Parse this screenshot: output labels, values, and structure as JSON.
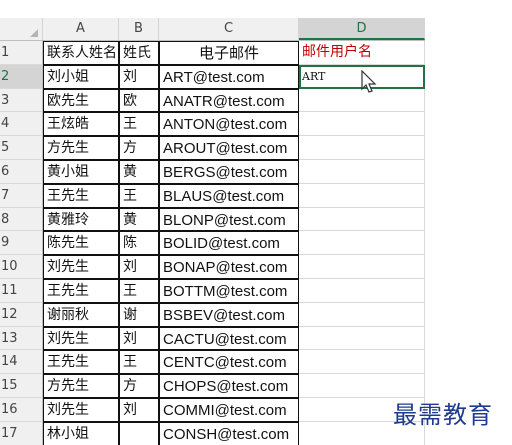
{
  "columns": [
    "A",
    "B",
    "C",
    "D"
  ],
  "header": {
    "row_num": "1",
    "contact_name": "联系人姓名",
    "surname": "姓氏",
    "email": "电子邮件",
    "username": "邮件用户名"
  },
  "rows": [
    {
      "num": "2",
      "name": "刘小姐",
      "surname": "刘",
      "email": "ART@test.com",
      "username": "ART"
    },
    {
      "num": "3",
      "name": "欧先生",
      "surname": "欧",
      "email": "ANATR@test.com",
      "username": ""
    },
    {
      "num": "4",
      "name": "王炫皓",
      "surname": "王",
      "email": "ANTON@test.com",
      "username": ""
    },
    {
      "num": "5",
      "name": "方先生",
      "surname": "方",
      "email": "AROUT@test.com",
      "username": ""
    },
    {
      "num": "6",
      "name": "黄小姐",
      "surname": "黄",
      "email": "BERGS@test.com",
      "username": ""
    },
    {
      "num": "7",
      "name": "王先生",
      "surname": "王",
      "email": "BLAUS@test.com",
      "username": ""
    },
    {
      "num": "8",
      "name": "黄雅玲",
      "surname": "黄",
      "email": "BLONP@test.com",
      "username": ""
    },
    {
      "num": "9",
      "name": "陈先生",
      "surname": "陈",
      "email": "BOLID@test.com",
      "username": ""
    },
    {
      "num": "10",
      "name": "刘先生",
      "surname": "刘",
      "email": "BONAP@test.com",
      "username": ""
    },
    {
      "num": "11",
      "name": "王先生",
      "surname": "王",
      "email": "BOTTM@test.com",
      "username": ""
    },
    {
      "num": "12",
      "name": "谢丽秋",
      "surname": "谢",
      "email": "BSBEV@test.com",
      "username": ""
    },
    {
      "num": "13",
      "name": "刘先生",
      "surname": "刘",
      "email": "CACTU@test.com",
      "username": ""
    },
    {
      "num": "14",
      "name": "王先生",
      "surname": "王",
      "email": "CENTC@test.com",
      "username": ""
    },
    {
      "num": "15",
      "name": "方先生",
      "surname": "方",
      "email": "CHOPS@test.com",
      "username": ""
    },
    {
      "num": "16",
      "name": "刘先生",
      "surname": "刘",
      "email": "COMMI@test.com",
      "username": ""
    },
    {
      "num": "17",
      "name": "林小姐",
      "surname": "",
      "email": "CONSH@test.com",
      "username": ""
    }
  ],
  "active_cell": "D2",
  "brand_watermark": "最需教育",
  "colors": {
    "accent": "#217346",
    "title_red": "#c00000",
    "brand": "#1f3b8f"
  }
}
